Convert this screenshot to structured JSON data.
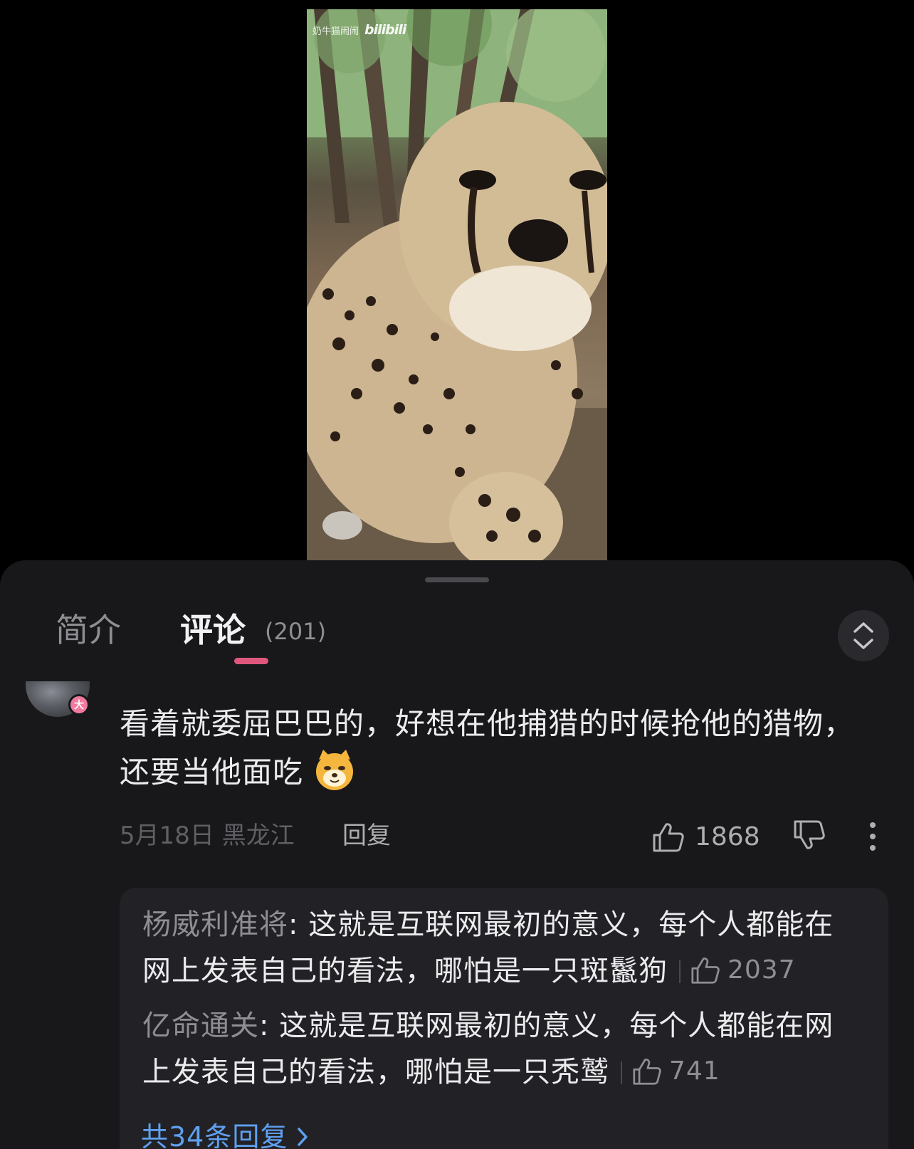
{
  "video": {
    "watermark_text": "奶牛猫闹闹",
    "watermark_logo": "bilibili"
  },
  "tabs": {
    "intro_label": "简介",
    "comments_label": "评论",
    "comments_count": "(201)"
  },
  "comment": {
    "avatar_badge": "大",
    "text": "看着就委屈巴巴的，好想在他捕猎的时候抢他的猎物，还要当他面吃",
    "emoji": "dog-face-emoji",
    "date_location": "5月18日 黑龙江",
    "reply_label": "回复",
    "like_count": "1868"
  },
  "replies": [
    {
      "author": "杨威利准将",
      "text": ": 这就是互联网最初的意义，每个人都能在网上发表自己的看法，哪怕是一只斑鬣狗",
      "like_count": "2037"
    },
    {
      "author": "亿命通关",
      "text": ": 这就是互联网最初的意义，每个人都能在网上发表自己的看法，哪怕是一只秃鹫",
      "like_count": "741"
    }
  ],
  "more_replies_label": "共34条回复",
  "colors": {
    "accent_pink": "#e0577d",
    "link_blue": "#5fa0f0",
    "panel_bg": "#18181a",
    "reply_bg": "#222226"
  }
}
